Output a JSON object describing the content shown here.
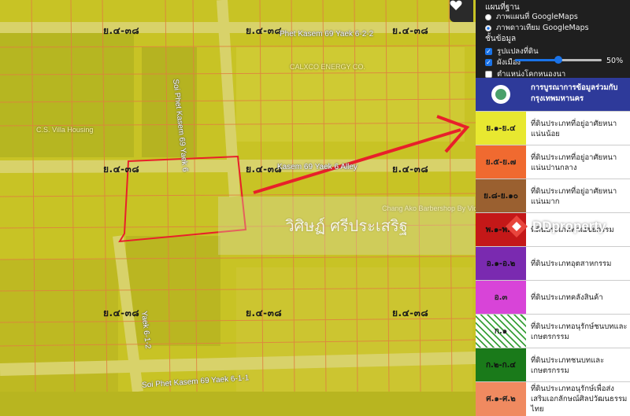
{
  "map": {
    "zone_label": "ย.๔-๓๘",
    "streets": {
      "phet_kasem_69_6_2_2": "Phet Kasem 69 Yaek 6-2-2",
      "kasem_69_6_alley": "Kasem 69 Yaek 6 Alley",
      "soi_phet_kasem_69_6_vertical": "Soi Phet Kasem 69 Yaek 6",
      "soi_phet_kasem_69_6_1_bottom": "Soi Phet Kasem 69 Yaek 6-1-1",
      "soi_69_6_1_2_vertical": "Yaek 6-1-2"
    },
    "pois": {
      "cs_villa": "C.S. Villa Housing",
      "calxco": "CALXCO ENERGY CO.",
      "chang_ako": "Chang Ako Barbershop By Victor"
    },
    "watermark": "วิศิษฏ์ ศรีประเสริฐ",
    "colors": {
      "overlay": "#c4c020",
      "parcel_line": "#e08040",
      "highlight": "#e8202a",
      "arrow": "#e8202a"
    }
  },
  "heart_icon": "heart-icon",
  "panel": {
    "basemap_title": "แผนที่ฐาน",
    "basemap_options": [
      {
        "label": "ภาพแผนที่ GoogleMaps",
        "selected": false
      },
      {
        "label": "ภาพดาวเทียม GoogleMaps",
        "selected": true
      }
    ],
    "layers_title": "ชั้นข้อมูล",
    "layers": [
      {
        "label": "รูปแปลงที่ดิน",
        "checked": true
      },
      {
        "label": "ผังเมือง",
        "checked": true
      },
      {
        "label": "ตำแหน่งโคกหนองนา",
        "checked": false
      }
    ],
    "opacity": {
      "value": 50,
      "label": "50%"
    }
  },
  "legend": {
    "header": "การบูรณาการข้อมูลร่วมกับ กรุงเทพมหานคร",
    "rows": [
      {
        "code": "ย.๑-ย.๔",
        "text": "ที่ดินประเภทที่อยู่อาศัยหนาแน่นน้อย",
        "color": "#e8e830"
      },
      {
        "code": "ย.๕-ย.๗",
        "text": "ที่ดินประเภทที่อยู่อาศัยหนาแน่นปานกลาง",
        "color": "#f06a30"
      },
      {
        "code": "ย.๘-ย.๑๐",
        "text": "ที่ดินประเภทที่อยู่อาศัยหนาแน่นมาก",
        "color": "#9a6030"
      },
      {
        "code": "พ.๑-พ.๕",
        "text": "ที่ดินประเภทพาณิชยกรรม",
        "color": "#c41818"
      },
      {
        "code": "อ.๑-อ.๒",
        "text": "ที่ดินประเภทอุตสาหกรรม",
        "color": "#7a2ab0"
      },
      {
        "code": "อ.๓",
        "text": "ที่ดินประเภทคลังสินค้า",
        "color": "#d844d8"
      },
      {
        "code": "ก.๑",
        "text": "ที่ดินประเภทอนุรักษ์ชนบทและเกษตรกรรม",
        "color": "#ffffff"
      },
      {
        "code": "ก.๒-ก.๔",
        "text": "ที่ดินประเภทชนบทและเกษตรกรรม",
        "color": "#1a7a1a"
      },
      {
        "code": "ศ.๑-ศ.๒",
        "text": "ที่ดินประเภทอนุรักษ์เพื่อส่งเสริมเอกลักษณ์ศิลปวัฒนธรรมไทย",
        "color": "#f08a60"
      }
    ]
  },
  "dd_logo": "DDproperty"
}
